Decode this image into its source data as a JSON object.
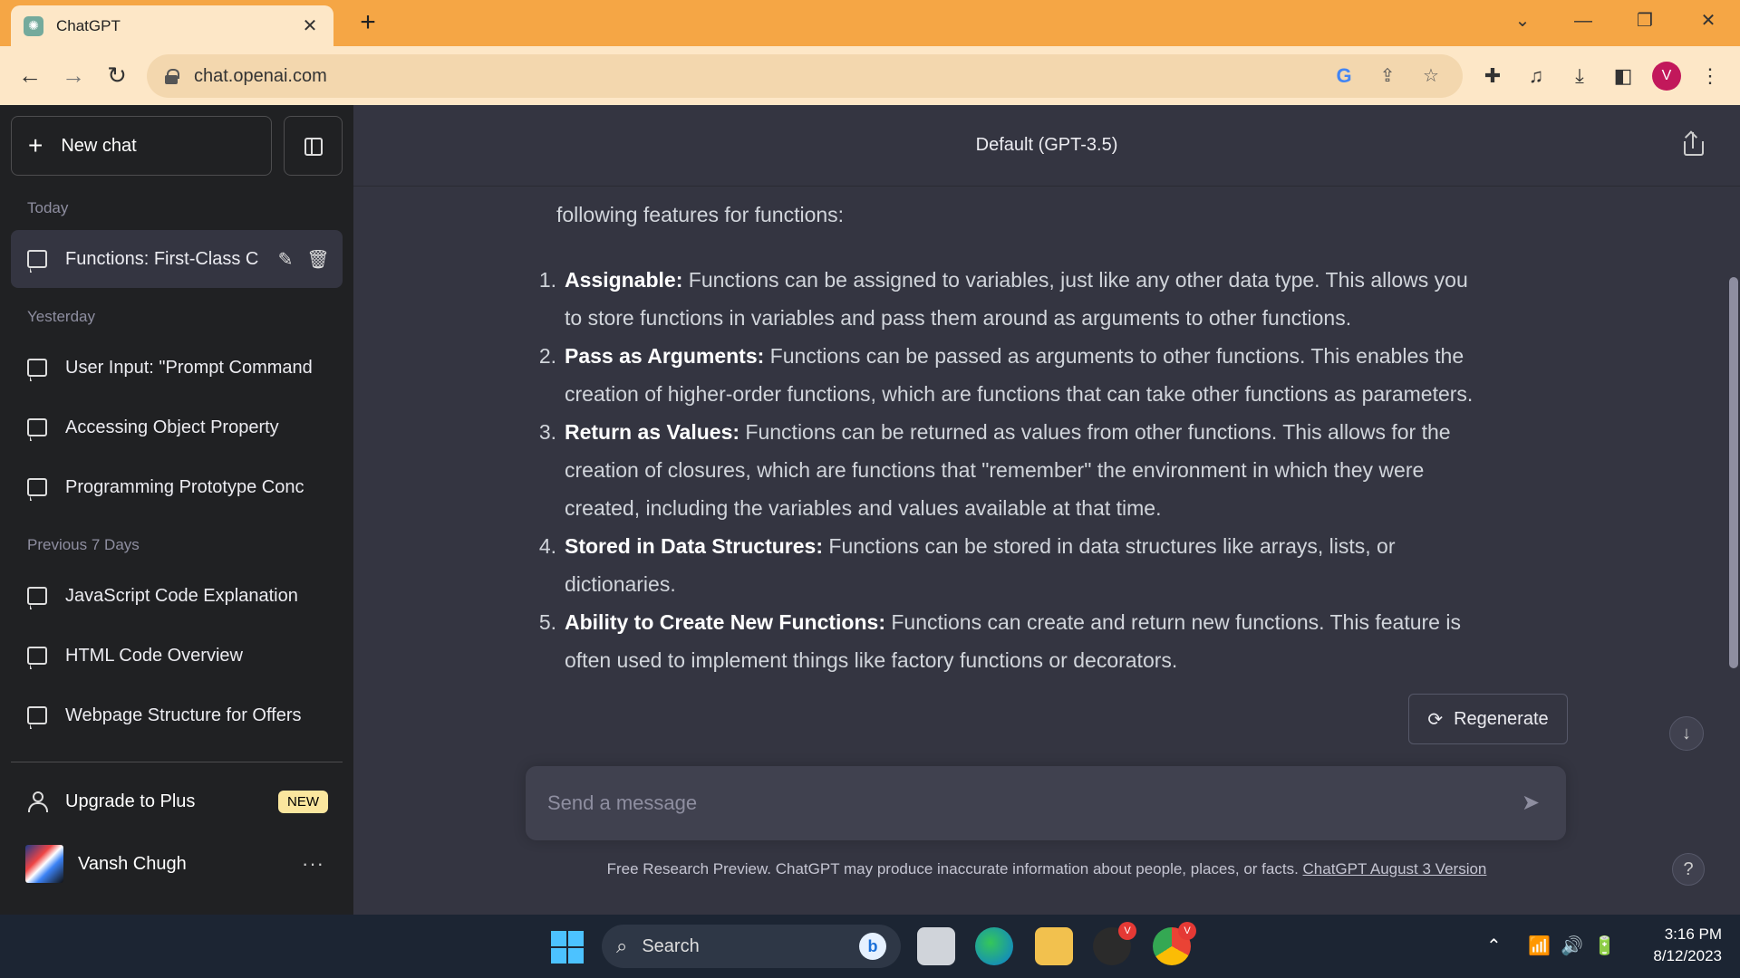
{
  "browser": {
    "tab_title": "ChatGPT",
    "tab_close": "✕",
    "new_tab": "+",
    "url": "chat.openai.com",
    "profile_initial": "V",
    "window_controls": {
      "dropdown": "⌄",
      "minimize": "—",
      "restore": "❐",
      "close": "✕"
    }
  },
  "sidebar": {
    "new_chat_label": "New chat",
    "sections": {
      "today": "Today",
      "yesterday": "Yesterday",
      "previous_7_days": "Previous 7 Days"
    },
    "active_chat": "Functions: First-Class C",
    "yesterday_items": [
      "User Input: \"Prompt Command",
      "Accessing Object Property",
      "Programming Prototype Conc"
    ],
    "previous_items": [
      "JavaScript Code Explanation",
      "HTML Code Overview",
      "Webpage Structure for Offers"
    ],
    "upgrade_label": "Upgrade to Plus",
    "upgrade_badge": "NEW",
    "user_name": "Vansh Chugh",
    "more": "···"
  },
  "main": {
    "model_title": "Default (GPT-3.5)",
    "intro_line": "following features for functions:",
    "features": [
      {
        "num": "1.",
        "title": "Assignable:",
        "text": " Functions can be assigned to variables, just like any other data type. This allows you to store functions in variables and pass them around as arguments to other functions."
      },
      {
        "num": "2.",
        "title": "Pass as Arguments:",
        "text": " Functions can be passed as arguments to other functions. This enables the creation of higher-order functions, which are functions that can take other functions as parameters."
      },
      {
        "num": "3.",
        "title": "Return as Values:",
        "text": " Functions can be returned as values from other functions. This allows for the creation of closures, which are functions that \"remember\" the environment in which they were created, including the variables and values available at that time."
      },
      {
        "num": "4.",
        "title": "Stored in Data Structures:",
        "text": " Functions can be stored in data structures like arrays, lists, or dictionaries."
      },
      {
        "num": "5.",
        "title": "Ability to Create New Functions:",
        "text": " Functions can create and return new functions. This feature is often used to implement things like factory functions or decorators."
      }
    ],
    "regenerate_label": "Regenerate",
    "composer_placeholder": "Send a message",
    "disclaimer_text": "Free Research Preview. ChatGPT may produce inaccurate information about people, places, or facts. ",
    "disclaimer_link": "ChatGPT August 3 Version",
    "help": "?"
  },
  "taskbar": {
    "search_label": "Search",
    "time": "3:16 PM",
    "date": "8/12/2023",
    "badge": "V"
  },
  "colors": {
    "tab_strip": "#f5a645",
    "toolbar": "#fde7c7",
    "sidebar": "#202123",
    "main": "#343541",
    "composer": "#40414f",
    "taskbar": "#1c2533"
  }
}
